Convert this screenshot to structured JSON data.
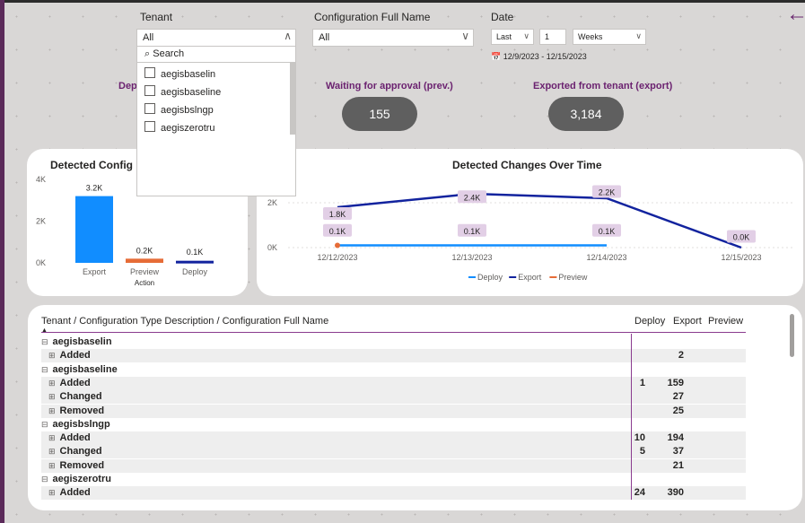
{
  "filters": {
    "tenant_label": "Tenant",
    "tenant_value": "All",
    "config_label": "Configuration Full Name",
    "config_value": "All",
    "date_label": "Date",
    "date_mode": "Last",
    "date_count": "1",
    "date_unit": "Weeks",
    "date_range": "12/9/2023 - 12/15/2023"
  },
  "tenant_dropdown": {
    "search_placeholder": "Search",
    "options": [
      "aegisbaselin",
      "aegisbaseline",
      "aegisbslngp",
      "aegiszerotru"
    ]
  },
  "kpis": {
    "hidden_label": "Dep",
    "waiting_label": "Waiting for approval (prev.)",
    "waiting_value": "155",
    "exported_label": "Exported from tenant (export)",
    "exported_value": "3,184"
  },
  "bar_card": {
    "title": "Detected Configuration",
    "title_visible": "Detected Config"
  },
  "line_card": {
    "title": "Detected Changes Over Time"
  },
  "chart_data": [
    {
      "type": "bar",
      "title": "Detected Configuration",
      "categories": [
        "Export",
        "Preview",
        "Deploy"
      ],
      "values": [
        3200,
        200,
        100
      ],
      "data_labels": [
        "3.2K",
        "0.2K",
        "0.1K"
      ],
      "colors": [
        "#118dff",
        "#e66c37",
        "#12239e"
      ],
      "xlabel": "Action",
      "yticks": [
        "0K",
        "2K",
        "4K"
      ],
      "ylim": [
        0,
        4000
      ]
    },
    {
      "type": "line",
      "title": "Detected Changes Over Time",
      "x": [
        "12/12/2023",
        "12/13/2023",
        "12/14/2023",
        "12/15/2023"
      ],
      "yticks": [
        "0K",
        "2K"
      ],
      "ylim": [
        0,
        2600
      ],
      "series": [
        {
          "name": "Deploy",
          "color": "#118dff",
          "values": [
            100,
            100,
            100,
            null
          ]
        },
        {
          "name": "Export",
          "color": "#12239e",
          "values": [
            1800,
            2400,
            2200,
            0
          ]
        },
        {
          "name": "Preview",
          "color": "#e66c37",
          "values": [
            100,
            null,
            null,
            null
          ]
        }
      ],
      "data_labels": [
        {
          "text": "1.8K"
        },
        {
          "text": "2.4K"
        },
        {
          "text": "2.2K"
        },
        {
          "text": "0.0K"
        },
        {
          "text": "0.1K"
        },
        {
          "text": "0.1K"
        },
        {
          "text": "0.1K"
        }
      ],
      "legend": [
        "Deploy",
        "Export",
        "Preview"
      ]
    }
  ],
  "matrix": {
    "header": "Tenant / Configuration Type Description / Configuration Full Name",
    "columns": [
      "Deploy",
      "Export",
      "Preview"
    ],
    "rows": [
      {
        "level": 0,
        "label": "aegisbaselin",
        "deploy": "",
        "export": "",
        "preview": ""
      },
      {
        "level": 1,
        "label": "Added",
        "deploy": "",
        "export": "2",
        "preview": ""
      },
      {
        "level": 0,
        "label": "aegisbaseline",
        "deploy": "",
        "export": "",
        "preview": ""
      },
      {
        "level": 1,
        "label": "Added",
        "deploy": "1",
        "export": "159",
        "preview": ""
      },
      {
        "level": 1,
        "label": "Changed",
        "deploy": "",
        "export": "27",
        "preview": ""
      },
      {
        "level": 1,
        "label": "Removed",
        "deploy": "",
        "export": "25",
        "preview": ""
      },
      {
        "level": 0,
        "label": "aegisbslngp",
        "deploy": "",
        "export": "",
        "preview": ""
      },
      {
        "level": 1,
        "label": "Added",
        "deploy": "10",
        "export": "194",
        "preview": ""
      },
      {
        "level": 1,
        "label": "Changed",
        "deploy": "5",
        "export": "37",
        "preview": ""
      },
      {
        "level": 1,
        "label": "Removed",
        "deploy": "",
        "export": "21",
        "preview": ""
      },
      {
        "level": 0,
        "label": "aegiszerotru",
        "deploy": "",
        "export": "",
        "preview": ""
      },
      {
        "level": 1,
        "label": "Added",
        "deploy": "24",
        "export": "390",
        "preview": ""
      }
    ]
  }
}
